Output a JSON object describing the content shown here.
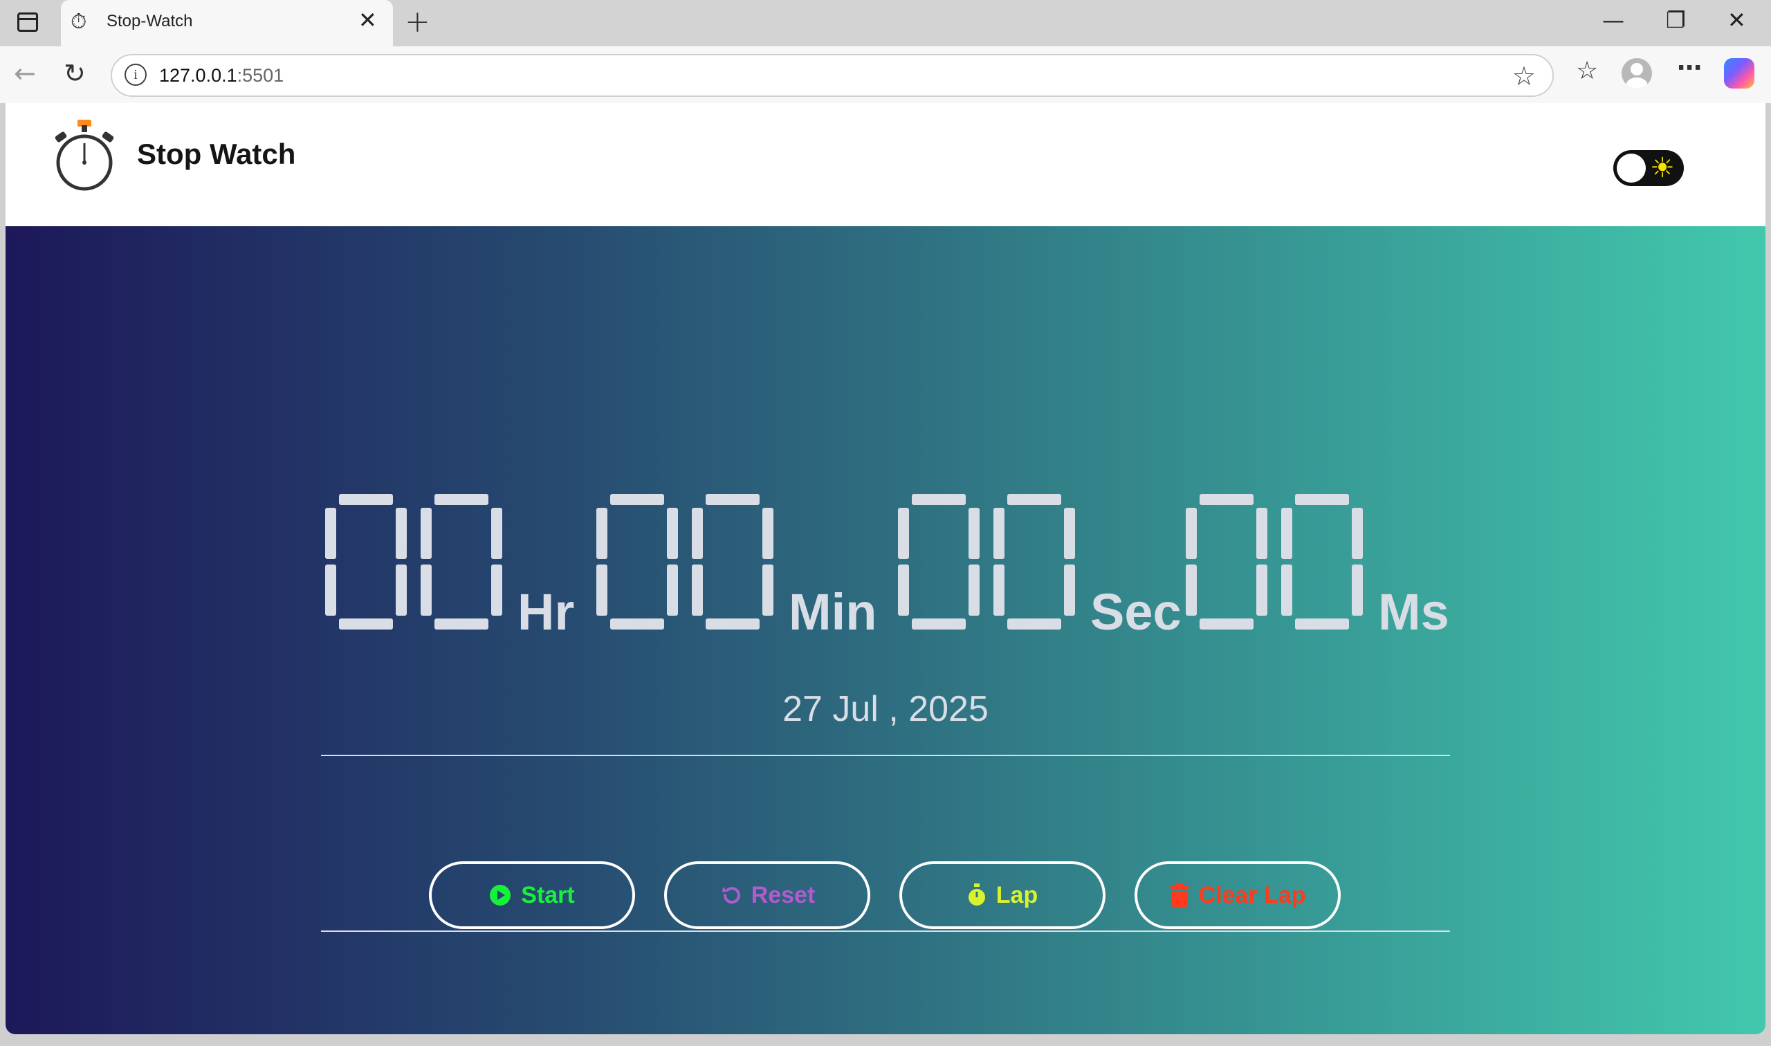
{
  "browser": {
    "tab_title": "Stop-Watch",
    "address_host": "127.0.0.1",
    "address_port": ":5501"
  },
  "header": {
    "brand": "Stop Watch",
    "theme_toggle": "dark-mode-toggle",
    "sun_icon": "☀"
  },
  "timer": {
    "hours": "00",
    "hours_unit": "Hr",
    "minutes": "00",
    "minutes_unit": "Min",
    "seconds": "00",
    "seconds_unit": "Sec",
    "milliseconds": "00",
    "milliseconds_unit": "Ms"
  },
  "date": "27 Jul , 2025",
  "controls": {
    "start": {
      "label": "Start",
      "color": "#16f23a",
      "icon": "play-circle-icon"
    },
    "reset": {
      "label": "Reset",
      "color": "#b35ad1",
      "icon": "reset-icon"
    },
    "lap": {
      "label": "Lap",
      "color": "#d8f230",
      "icon": "stopwatch-icon"
    },
    "clear_lap": {
      "label": "Clear Lap",
      "color": "#ff3a1d",
      "icon": "trash-icon"
    }
  },
  "colors": {
    "digit": "#d8dde6",
    "gradient_start": "#1d185a",
    "gradient_end": "#42c8ad"
  }
}
